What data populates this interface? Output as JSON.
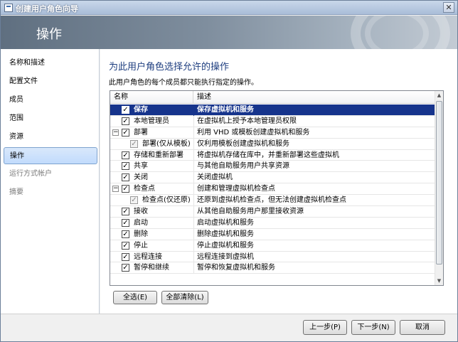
{
  "window": {
    "title": "创建用户角色向导"
  },
  "banner": {
    "heading": "操作"
  },
  "sidebar": {
    "items": [
      {
        "label": "名称和描述"
      },
      {
        "label": "配置文件"
      },
      {
        "label": "成员"
      },
      {
        "label": "范围"
      },
      {
        "label": "资源"
      },
      {
        "label": "操作"
      },
      {
        "label": "运行方式帐户"
      },
      {
        "label": "摘要"
      }
    ],
    "active_index": 5
  },
  "main": {
    "title": "为此用户角色选择允许的操作",
    "description": "此用户角色的每个成员都只能执行指定的操作。",
    "columns": {
      "name": "名称",
      "description": "描述"
    },
    "rows": [
      {
        "name": "保存",
        "description": "保存虚拟机和服务",
        "checked": true
      },
      {
        "name": "本地管理员",
        "description": "在虚拟机上授予本地管理员权限",
        "checked": true
      },
      {
        "name": "部署",
        "description": "利用 VHD 或模板创建虚拟机和服务",
        "checked": true,
        "expander": "−"
      },
      {
        "name": "部署(仅从模板)",
        "description": "仅利用模板创建虚拟机和服务",
        "checked": true,
        "child": true
      },
      {
        "name": "存储和重新部署",
        "description": "将虚拟机存储在库中，并重新部署这些虚拟机",
        "checked": true
      },
      {
        "name": "共享",
        "description": "与其他自助服务用户共享资源",
        "checked": true
      },
      {
        "name": "关闭",
        "description": "关闭虚拟机",
        "checked": true
      },
      {
        "name": "检查点",
        "description": "创建和管理虚拟机检查点",
        "checked": true,
        "expander": "−"
      },
      {
        "name": "检查点(仅还原)",
        "description": "还原到虚拟机检查点，但无法创建虚拟机检查点",
        "checked": true,
        "child": true
      },
      {
        "name": "接收",
        "description": "从其他自助服务用户那里接收资源",
        "checked": true
      },
      {
        "name": "启动",
        "description": "启动虚拟机和服务",
        "checked": true
      },
      {
        "name": "删除",
        "description": "删除虚拟机和服务",
        "checked": true
      },
      {
        "name": "停止",
        "description": "停止虚拟机和服务",
        "checked": true
      },
      {
        "name": "远程连接",
        "description": "远程连接到虚拟机",
        "checked": true
      },
      {
        "name": "暂停和继续",
        "description": "暂停和恢复虚拟机和服务",
        "checked": true
      }
    ],
    "selected_index": 0,
    "select_all_label": "全选(E)",
    "clear_all_label": "全部清除(L)"
  },
  "footer": {
    "back_label": "上一步(P)",
    "next_label": "下一步(N)",
    "cancel_label": "取消"
  },
  "colors": {
    "selection": "#16348c",
    "title_text": "#1f3f80",
    "active_nav": "#c1dbfc"
  },
  "icons": [
    "app-icon",
    "close-icon",
    "checkbox-icon",
    "collapse-icon",
    "scroll-up-icon",
    "scroll-down-icon"
  ]
}
